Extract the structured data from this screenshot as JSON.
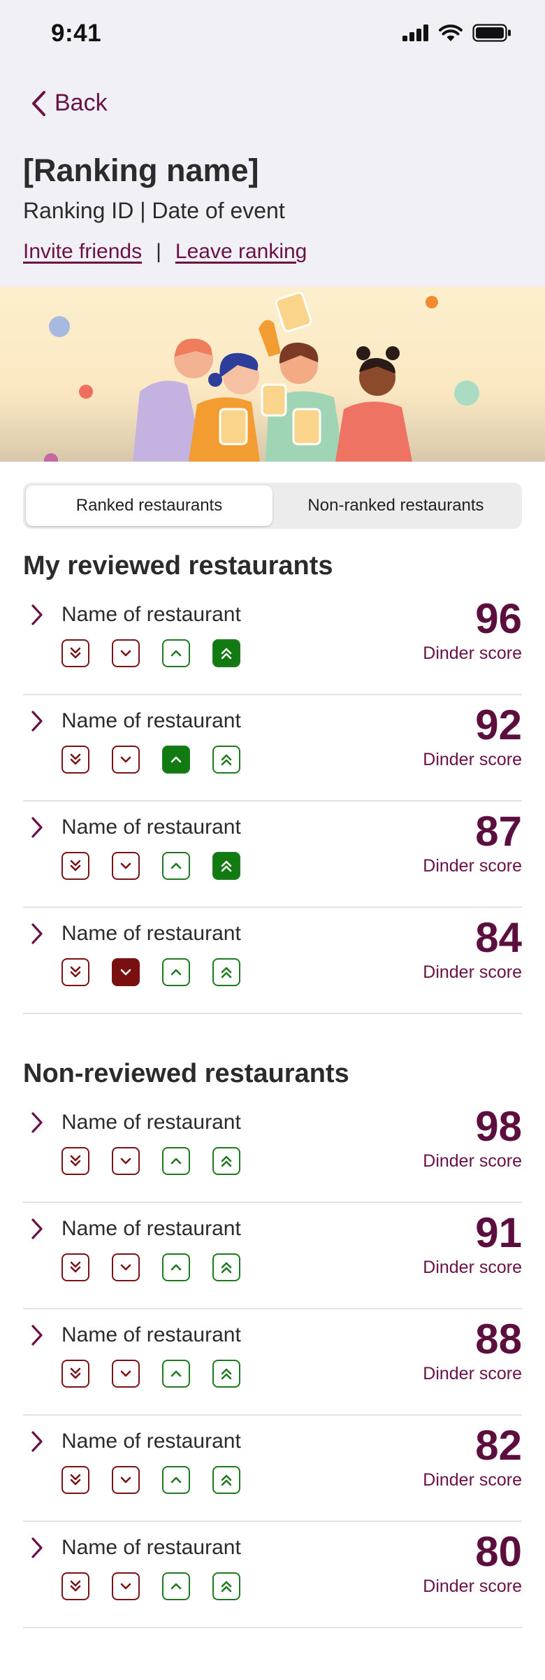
{
  "status_bar": {
    "time": "9:41"
  },
  "nav": {
    "back_label": "Back"
  },
  "header": {
    "title": "[Ranking name]",
    "subtitle": "Ranking ID | Date of event",
    "invite_label": "Invite friends",
    "separator": "|",
    "leave_label": "Leave ranking"
  },
  "tabs": [
    {
      "label": "Ranked restaurants",
      "active": true
    },
    {
      "label": "Non-ranked restaurants",
      "active": false
    }
  ],
  "reviewed": {
    "title": "My reviewed restaurants",
    "items": [
      {
        "name": "Name of restaurant",
        "score": "96",
        "score_label": "Dinder score",
        "vote": "strong-up"
      },
      {
        "name": "Name of restaurant",
        "score": "92",
        "score_label": "Dinder score",
        "vote": "up"
      },
      {
        "name": "Name of restaurant",
        "score": "87",
        "score_label": "Dinder score",
        "vote": "strong-up"
      },
      {
        "name": "Name of restaurant",
        "score": "84",
        "score_label": "Dinder score",
        "vote": "down"
      }
    ]
  },
  "non_reviewed": {
    "title": "Non-reviewed restaurants",
    "items": [
      {
        "name": "Name of restaurant",
        "score": "98",
        "score_label": "Dinder score",
        "vote": "none"
      },
      {
        "name": "Name of restaurant",
        "score": "91",
        "score_label": "Dinder score",
        "vote": "none"
      },
      {
        "name": "Name of restaurant",
        "score": "88",
        "score_label": "Dinder score",
        "vote": "none"
      },
      {
        "name": "Name of restaurant",
        "score": "82",
        "score_label": "Dinder score",
        "vote": "none"
      },
      {
        "name": "Name of restaurant",
        "score": "80",
        "score_label": "Dinder score",
        "vote": "none"
      }
    ]
  },
  "colors": {
    "accent": "#6b1245",
    "score": "#5c0f3e",
    "down": "#7a1216",
    "up": "#1f7a1f"
  }
}
